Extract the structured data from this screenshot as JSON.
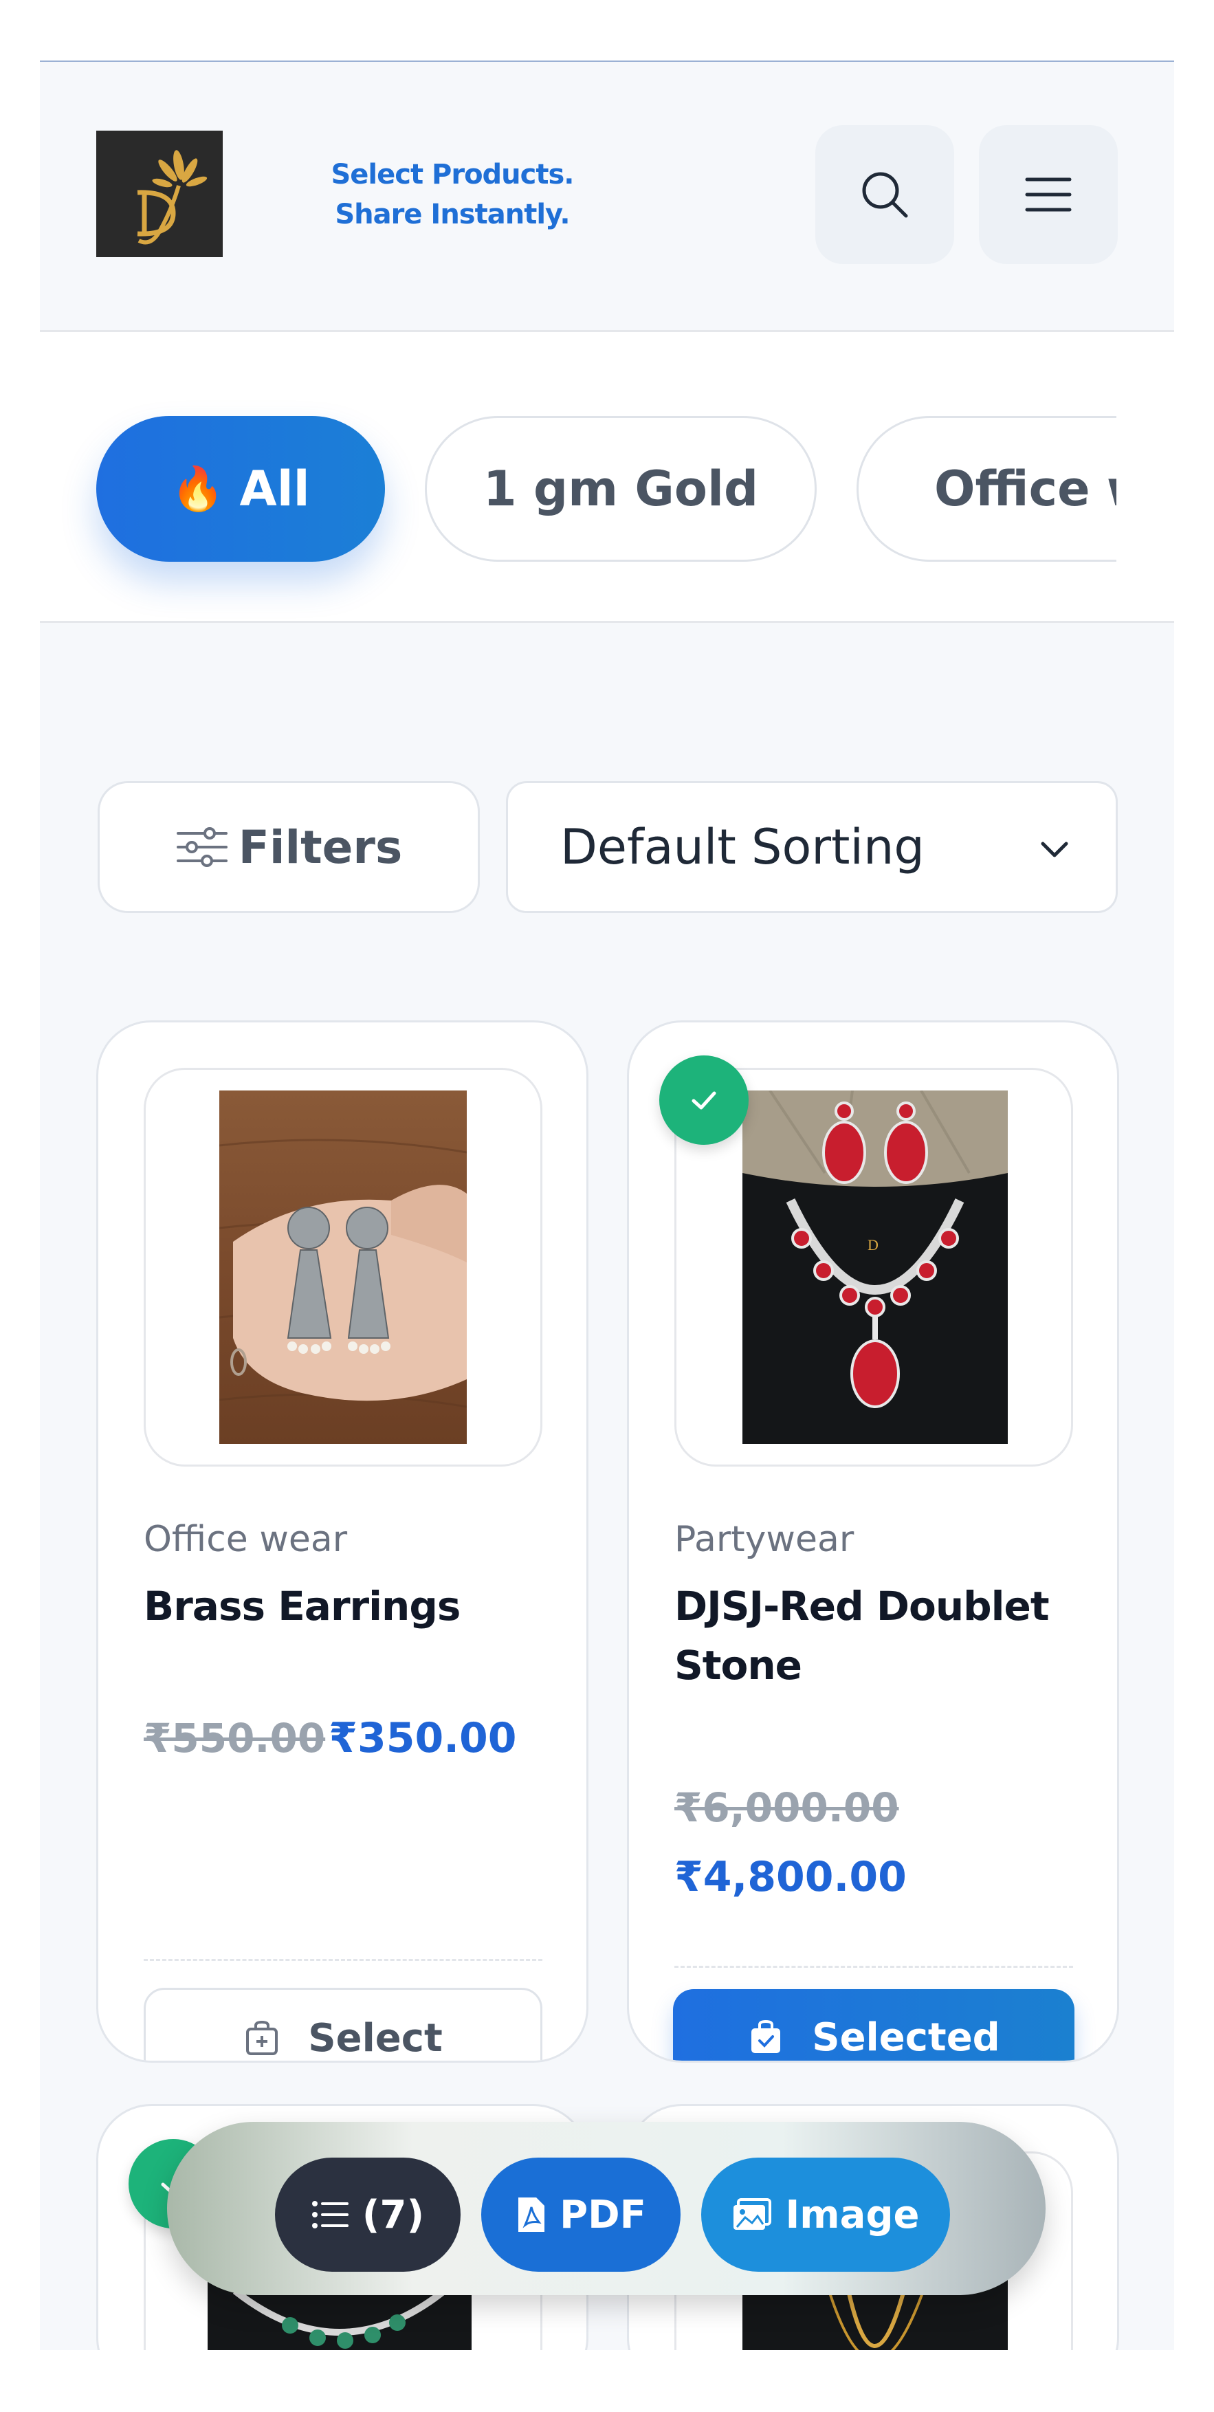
{
  "header": {
    "logo_alt": "D logo",
    "tagline_line1": "Select Products.",
    "tagline_line2": "Share Instantly."
  },
  "categories": [
    {
      "label": "All",
      "icon": "flame-icon",
      "active": true
    },
    {
      "label": "1 gm Gold",
      "active": false
    },
    {
      "label": "Office w",
      "active": false
    }
  ],
  "toolbar": {
    "filters_label": "Filters",
    "sort_selected": "Default Sorting"
  },
  "products": [
    {
      "category": "Office wear",
      "title": "Brass Earrings",
      "price_old": "₹550.00",
      "price_new": "₹350.00",
      "button_label": "Select",
      "selected": false
    },
    {
      "category": "Partywear",
      "title": "DJSJ-Red Doublet Stone",
      "price_old": "₹6,000.00",
      "price_new": "₹4,800.00",
      "button_label": "Selected",
      "selected": true
    }
  ],
  "action_bar": {
    "list_label": "(7)",
    "pdf_label": "PDF",
    "image_label": "Image"
  },
  "colors": {
    "accent": "#1f6fe0",
    "price": "#1f64d6",
    "selected_badge": "#1db37a",
    "tagline": "#1f6fd6"
  }
}
